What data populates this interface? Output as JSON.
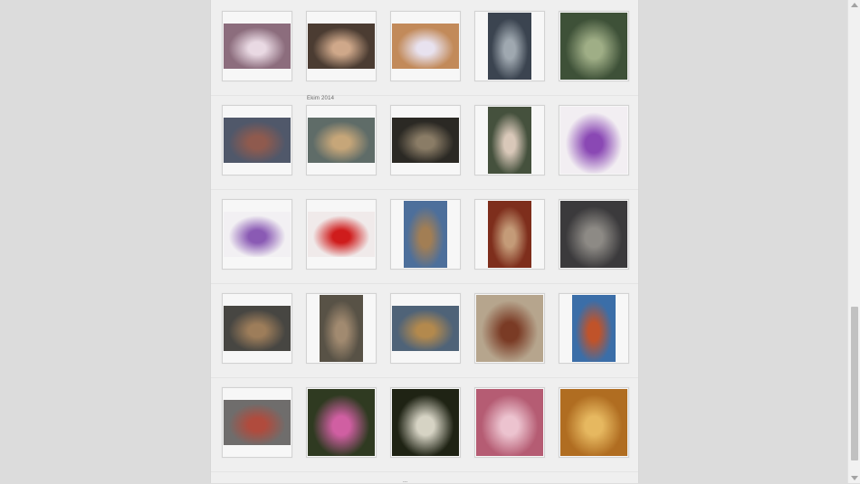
{
  "gallery": {
    "month_label": "Ekim 2014",
    "footer_text": "...",
    "rows": [
      {
        "items": [
          {
            "name": "baby-sleeping-photo",
            "bg": "#8c6d7d",
            "fg": "#e9d9e3"
          },
          {
            "name": "baby-face-photo",
            "bg": "#4b3c32",
            "fg": "#cfa88a"
          },
          {
            "name": "newborn-basket-photo",
            "bg": "#c28a5a",
            "fg": "#e8e2ef"
          },
          {
            "name": "street-buildings-photo",
            "bg": "#3b4450",
            "fg": "#9fa8b0"
          },
          {
            "name": "green-swamp-photo",
            "bg": "#3e5138",
            "fg": "#9fae86"
          }
        ]
      },
      {
        "items": [
          {
            "name": "street-cars-photo",
            "bg": "#50586a",
            "fg": "#8f5a4e"
          },
          {
            "name": "football-goal-kids-photo",
            "bg": "#5f6c68",
            "fg": "#c6a679"
          },
          {
            "name": "bicycle-dark-room-photo",
            "bg": "#2b2924",
            "fg": "#8a7c66"
          },
          {
            "name": "old-woman-headscarf-photo",
            "bg": "#45513d",
            "fg": "#d9c8b9"
          },
          {
            "name": "purple-ribbon-photo",
            "bg": "#f2eef2",
            "fg": "#8a48b4"
          }
        ]
      },
      {
        "items": [
          {
            "name": "purple-pattern-photo",
            "bg": "#f2f0f3",
            "fg": "#8a5ab4"
          },
          {
            "name": "turkish-flag-photo",
            "bg": "#f0eaea",
            "fg": "#cf1c1c"
          },
          {
            "name": "blue-doorway-photo",
            "bg": "#4d6f9b",
            "fg": "#a27e54"
          },
          {
            "name": "woman-red-doorway-photo",
            "bg": "#7e2e1c",
            "fg": "#c49b78"
          },
          {
            "name": "old-man-sitting-photo",
            "bg": "#3b3a3c",
            "fg": "#8d8a85"
          }
        ]
      },
      {
        "items": [
          {
            "name": "ship-interior-photo",
            "bg": "#474642",
            "fg": "#9d7d5a"
          },
          {
            "name": "ruined-hall-photo",
            "bg": "#585246",
            "fg": "#a18a70"
          },
          {
            "name": "ottoman-house-photo",
            "bg": "#4f6378",
            "fg": "#b3894d"
          },
          {
            "name": "wall-bicycle-photo",
            "bg": "#b6a58d",
            "fg": "#7a3b25"
          },
          {
            "name": "blue-wall-door-photo",
            "bg": "#3b6ea8",
            "fg": "#c0532a"
          }
        ]
      },
      {
        "items": [
          {
            "name": "houses-reflection-photo",
            "bg": "#6f6d6c",
            "fg": "#b04b3d"
          },
          {
            "name": "pink-tulip-photo",
            "bg": "#2f3a21",
            "fg": "#d05fa2"
          },
          {
            "name": "dandelion-photo",
            "bg": "#1f2314",
            "fg": "#d6d3c4"
          },
          {
            "name": "butterfly-flower-photo",
            "bg": "#b55c73",
            "fg": "#ecc3cf"
          },
          {
            "name": "branch-wall-photo",
            "bg": "#b06d21",
            "fg": "#e6b860"
          }
        ]
      }
    ]
  }
}
